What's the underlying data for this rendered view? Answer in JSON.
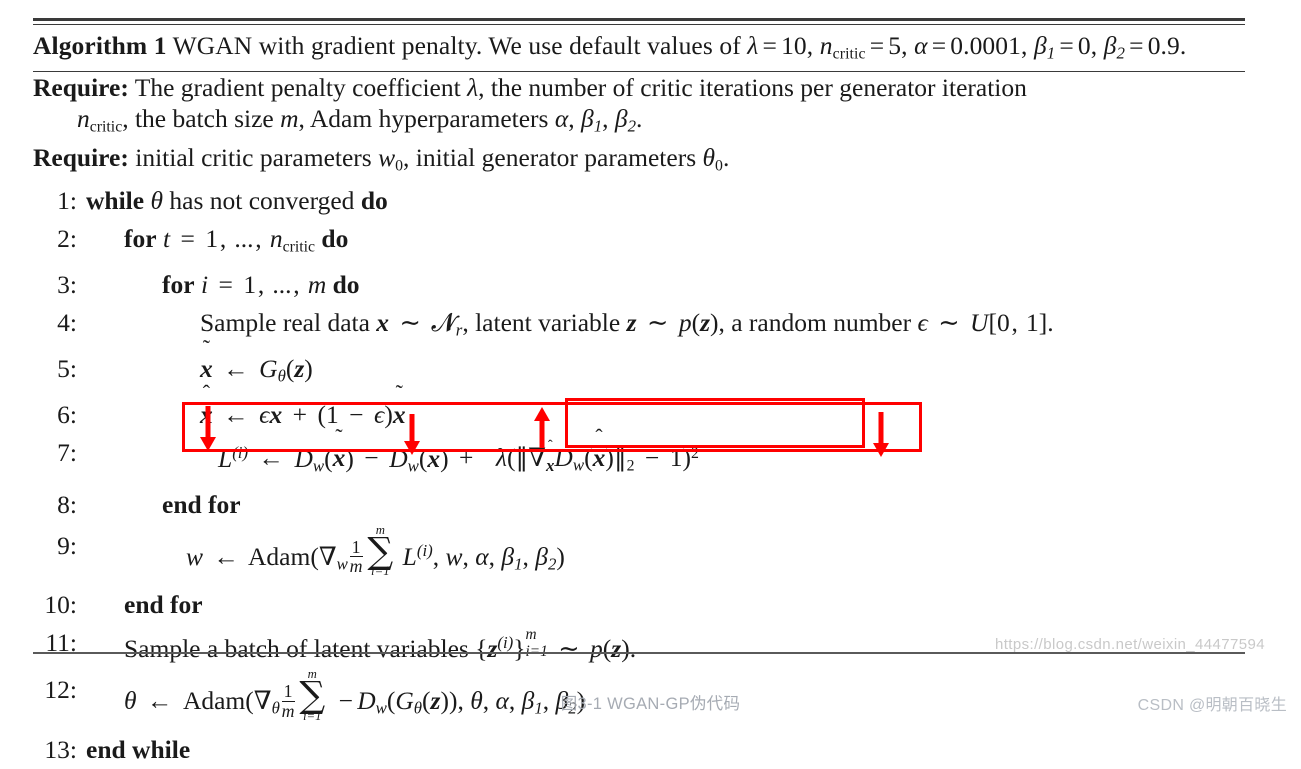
{
  "document": {
    "algorithm_number": "Algorithm 1",
    "title_text": "WGAN with gradient penalty. We use default values of",
    "title_defaults": "λ = 10, n_critic = 5, α = 0.0001, β₁ = 0, β₂ = 0.9.",
    "require_label": "Require:",
    "require_1": "The gradient penalty coefficient λ, the number of critic iterations per generator iteration n_critic, the batch size m, Adam hyperparameters α, β₁, β₂.",
    "require_2": "initial critic parameters w₀, initial generator parameters θ₀.",
    "lambda_value": "10",
    "n_critic_value": "5",
    "alpha_value": "0.0001",
    "beta1_value": "0",
    "beta2_value": "0.9"
  },
  "steps": [
    {
      "num": "1:",
      "indent": 0,
      "text": "while θ has not converged do"
    },
    {
      "num": "2:",
      "indent": 1,
      "text": "for t = 1, ..., n_critic do"
    },
    {
      "num": "3:",
      "indent": 2,
      "text": "for i = 1, ..., m do"
    },
    {
      "num": "4:",
      "indent": 3,
      "text": "Sample real data x ~ P_r, latent variable z ~ p(z), a random number ϵ ~ U[0, 1]."
    },
    {
      "num": "5:",
      "indent": 3,
      "text": "x̃ ← G_θ(z)"
    },
    {
      "num": "6:",
      "indent": 3,
      "text": "x̂ ← ϵx + (1 − ϵ)x̃"
    },
    {
      "num": "7:",
      "indent": 3,
      "text": "L⁽ⁱ⁾ ← D_w(x̃) − D_w(x) + λ(‖∇_x̂ D_w(x̂)‖₂ − 1)²"
    },
    {
      "num": "8:",
      "indent": 2,
      "text": "end for"
    },
    {
      "num": "9:",
      "indent": 2,
      "text": "w ← Adam(∇_w (1/m) Σᵢ₌₁ᵐ L⁽ⁱ⁾, w, α, β₁, β₂)"
    },
    {
      "num": "10:",
      "indent": 1,
      "text": "end for"
    },
    {
      "num": "11:",
      "indent": 1,
      "text": "Sample a batch of latent variables {z⁽ⁱ⁾}ᵢ₌₁ᵐ ~ p(z)."
    },
    {
      "num": "12:",
      "indent": 1,
      "text": "θ ← Adam(∇_θ (1/m) Σᵢ₌₁ᵐ −D_w(G_θ(z)), θ, α, β₁, β₂)"
    },
    {
      "num": "13:",
      "indent": 0,
      "text": "end while"
    }
  ],
  "annotations": {
    "accent_color": "#ff0000",
    "outer_box_label": "highlight-box-loss-line",
    "inner_box_label": "highlight-box-gradient-penalty",
    "arrow_count": 4,
    "arrows": [
      {
        "name": "arrow-down-loss",
        "direction": "down"
      },
      {
        "name": "arrow-down-fake-term",
        "direction": "down"
      },
      {
        "name": "arrow-up-real-term",
        "direction": "up"
      },
      {
        "name": "arrow-down-penalty-margin",
        "direction": "down"
      }
    ]
  },
  "footer": {
    "watermark": "https://blog.csdn.net/weixin_44477594",
    "caption": "图3-1 WGAN-GP伪代码",
    "credit": "CSDN @明朝百晓生"
  }
}
